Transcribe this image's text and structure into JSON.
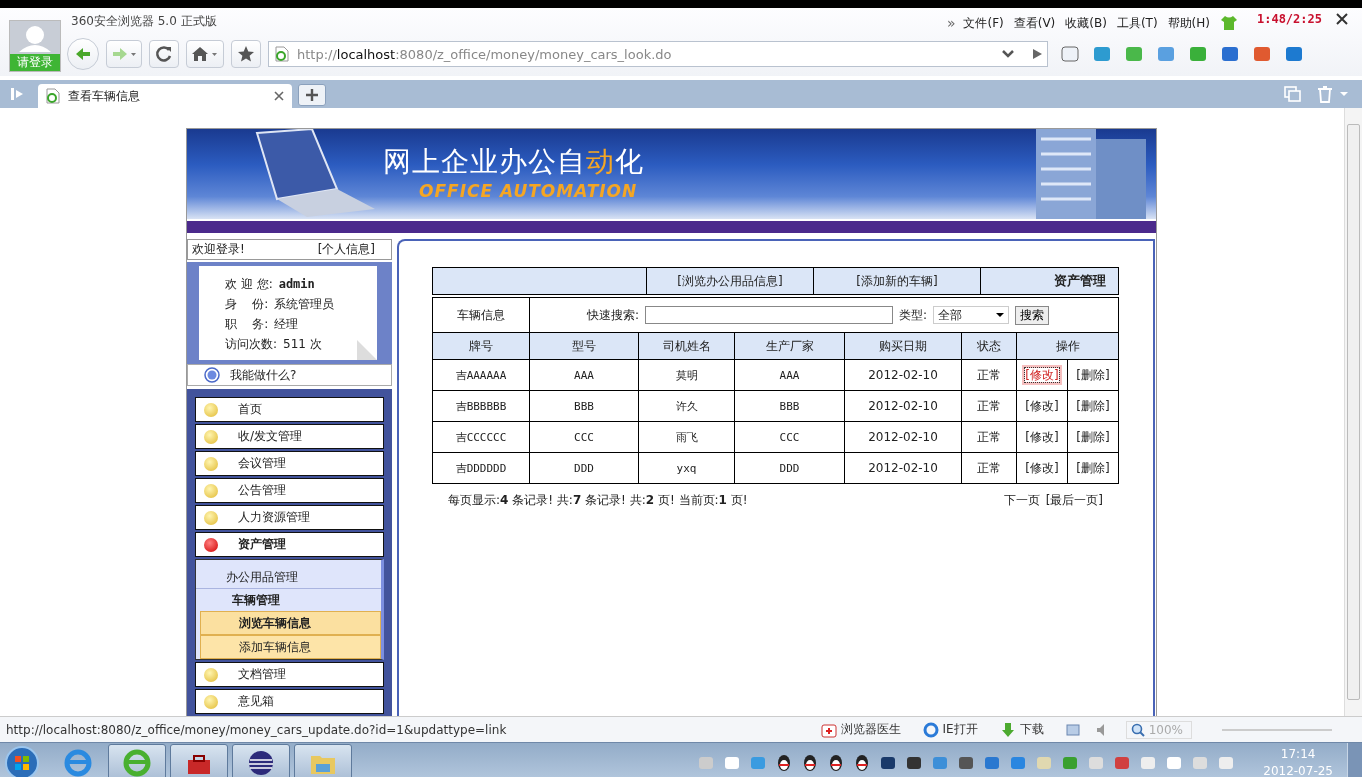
{
  "browser": {
    "login": "请登录",
    "title": "360安全浏览器 5.0 正式版",
    "more": "»",
    "menu": [
      "文件(F)",
      "查看(V)",
      "收藏(B)",
      "工具(T)",
      "帮助(H)"
    ],
    "overlay_time": "1:48/2:25",
    "address": {
      "scheme": "http://",
      "host": "localhost",
      "path": ":8080/z_office/money/money_cars_look.do"
    },
    "tabs": [
      {
        "label": "查看车辆信息",
        "selected": true
      }
    ]
  },
  "banner": {
    "title": [
      {
        "text": "网上企业办公自",
        "accent": false
      },
      {
        "text": "动",
        "accent": true
      },
      {
        "text": "化",
        "accent": false
      }
    ],
    "subtitle": "OFFICE AUTOMATION"
  },
  "sidebar": {
    "welcome": "欢迎登录!",
    "profile_link": "[个人信息]",
    "user_info": [
      {
        "label": "欢 迎 您:",
        "value": "admin",
        "bold": true
      },
      {
        "label": "身    份:",
        "value": "系统管理员",
        "bold": false
      },
      {
        "label": "职    务:",
        "value": "经理",
        "bold": false
      },
      {
        "label": "访问次数:",
        "value": "511 次",
        "bold": false
      }
    ],
    "help": "我能做什么?",
    "nav": [
      {
        "label": "首页",
        "selected": false
      },
      {
        "label": "收/发文管理",
        "selected": false
      },
      {
        "label": "会议管理",
        "selected": false
      },
      {
        "label": "公告管理",
        "selected": false
      },
      {
        "label": "人力资源管理",
        "selected": false
      },
      {
        "label": "资产管理",
        "selected": true,
        "children": [
          {
            "label": "办公用品管理",
            "selected": false
          },
          {
            "label": "车辆管理",
            "selected": true,
            "children": [
              {
                "label": "浏览车辆信息",
                "selected": true
              },
              {
                "label": "添加车辆信息",
                "selected": false
              }
            ]
          }
        ]
      },
      {
        "label": "文档管理",
        "selected": false
      },
      {
        "label": "意见箱",
        "selected": false
      }
    ]
  },
  "content": {
    "links": [
      "[浏览办公用品信息]",
      "[添加新的车辆]"
    ],
    "section": "资产管理",
    "search": {
      "title": "车辆信息",
      "label": "快速搜索:",
      "type_label": "类型:",
      "type_value": "全部",
      "button": "搜索"
    },
    "columns": [
      "牌号",
      "型号",
      "司机姓名",
      "生产厂家",
      "购买日期",
      "状态",
      "操作"
    ],
    "rows": [
      {
        "cells": [
          "吉AAAAAA",
          "AAA",
          "莫明",
          "AAA",
          "2012-02-10",
          "正常"
        ],
        "actions": [
          {
            "label": "[修改]",
            "focused": true
          },
          {
            "label": "[删除]",
            "focused": false
          }
        ]
      },
      {
        "cells": [
          "吉BBBBBB",
          "BBB",
          "许久",
          "BBB",
          "2012-02-10",
          "正常"
        ],
        "actions": [
          {
            "label": "[修改]",
            "focused": false
          },
          {
            "label": "[删除]",
            "focused": false
          }
        ]
      },
      {
        "cells": [
          "吉CCCCCC",
          "CCC",
          "雨飞",
          "CCC",
          "2012-02-10",
          "正常"
        ],
        "actions": [
          {
            "label": "[修改]",
            "focused": false
          },
          {
            "label": "[删除]",
            "focused": false
          }
        ]
      },
      {
        "cells": [
          "吉DDDDDD",
          "DDD",
          "yxq",
          "DDD",
          "2012-02-10",
          "正常"
        ],
        "actions": [
          {
            "label": "[修改]",
            "focused": false
          },
          {
            "label": "[删除]",
            "focused": false
          }
        ]
      }
    ],
    "pagination": {
      "summary": "每页显示:**4** 条记录! 共:**7** 条记录! 共:**2** 页! 当前页:**1** 页!",
      "links": [
        "下一页",
        "[最后一页]"
      ]
    }
  },
  "status_bar": {
    "url": "http://localhost:8080/z_office/money/money_cars_update.do?id=1&updattype=link",
    "items": [
      "浏览器医生",
      "IE打开",
      "下载"
    ],
    "zoom": "100%"
  },
  "taskbar": {
    "time": "17:14",
    "date": "2012-07-25"
  }
}
